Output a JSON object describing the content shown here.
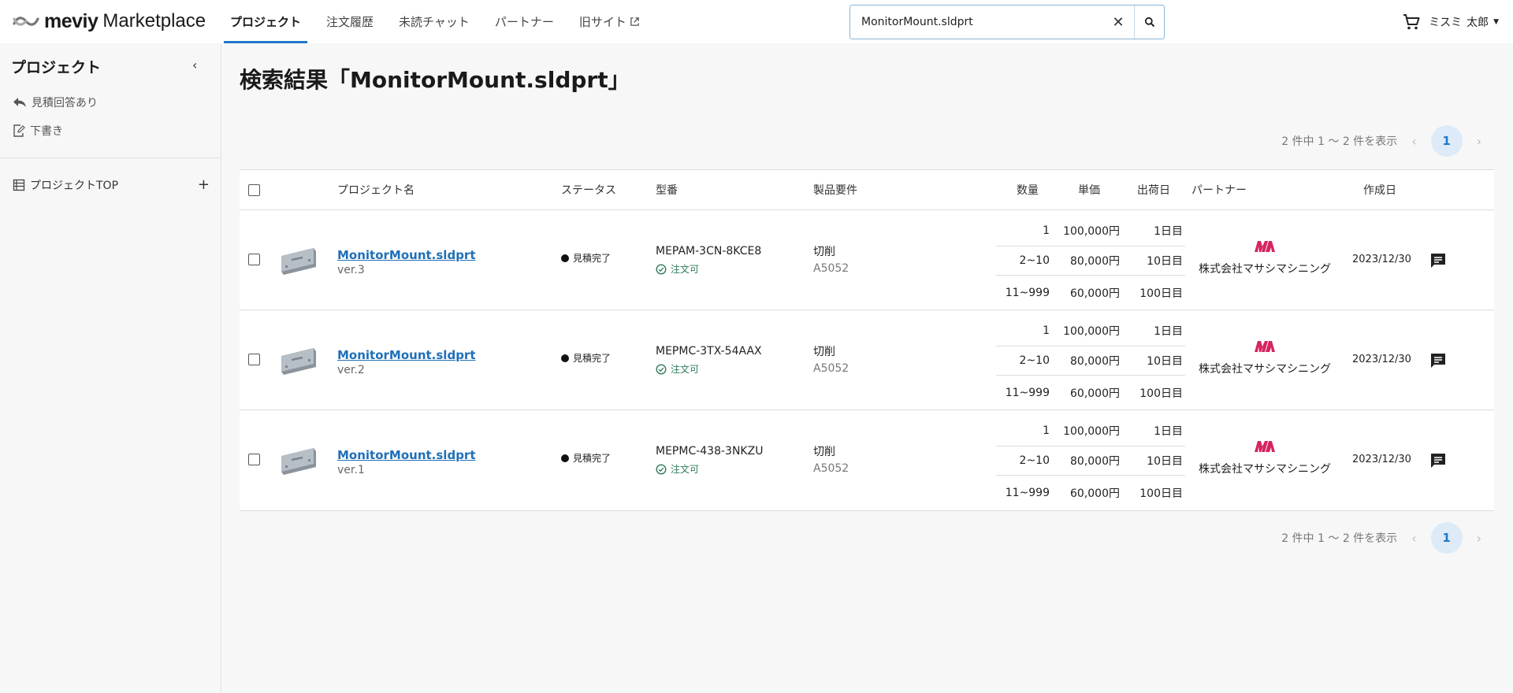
{
  "header": {
    "brand": "meviy",
    "brand_sub": "Marketplace",
    "nav": [
      "プロジェクト",
      "注文履歴",
      "未読チャット",
      "パートナー",
      "旧サイト"
    ],
    "search": {
      "value": "MonitorMount.sldprt",
      "clear": "✕"
    },
    "user": {
      "family": "ミスミ",
      "given": "太郎"
    }
  },
  "sidebar": {
    "title": "プロジェクト",
    "collapse": "‹",
    "links": [
      "見積回答あり",
      "下書き"
    ],
    "project_top": "プロジェクトTOP",
    "add": "+"
  },
  "main": {
    "title": "検索結果「MonitorMount.sldprt」",
    "pagination": {
      "summary": "2 件中 1 〜 2 件を表示",
      "current_page": "1",
      "prev": "‹",
      "next": "›"
    },
    "columns": {
      "name": "プロジェクト名",
      "status": "ステータス",
      "model": "型番",
      "requirements": "製品要件",
      "quantity": "数量",
      "unit_price": "単価",
      "ship_day": "出荷日",
      "partner": "パートナー",
      "created": "作成日"
    },
    "rows": [
      {
        "name": "MonitorMount.sldprt",
        "version": "ver.3",
        "status": "見積完了",
        "model": "MEPAM-3CN-8KCE8",
        "orderable": "注文可",
        "process": "切削",
        "material": "A5052",
        "prices": [
          {
            "qty": "1",
            "price": "100,000円",
            "days": "1日目"
          },
          {
            "qty": "2~10",
            "price": "80,000円",
            "days": "10日目"
          },
          {
            "qty": "11~999",
            "price": "60,000円",
            "days": "100日目"
          }
        ],
        "partner": "株式会社マサシマシニング",
        "created": "2023/12/30"
      },
      {
        "name": "MonitorMount.sldprt",
        "version": "ver.2",
        "status": "見積完了",
        "model": "MEPMC-3TX-54AAX",
        "orderable": "注文可",
        "process": "切削",
        "material": "A5052",
        "prices": [
          {
            "qty": "1",
            "price": "100,000円",
            "days": "1日目"
          },
          {
            "qty": "2~10",
            "price": "80,000円",
            "days": "10日目"
          },
          {
            "qty": "11~999",
            "price": "60,000円",
            "days": "100日目"
          }
        ],
        "partner": "株式会社マサシマシニング",
        "created": "2023/12/30"
      },
      {
        "name": "MonitorMount.sldprt",
        "version": "ver.1",
        "status": "見積完了",
        "model": "MEPMC-438-3NKZU",
        "orderable": "注文可",
        "process": "切削",
        "material": "A5052",
        "prices": [
          {
            "qty": "1",
            "price": "100,000円",
            "days": "1日目"
          },
          {
            "qty": "2~10",
            "price": "80,000円",
            "days": "10日目"
          },
          {
            "qty": "11~999",
            "price": "60,000円",
            "days": "100日目"
          }
        ],
        "partner": "株式会社マサシマシニング",
        "created": "2023/12/30"
      }
    ]
  },
  "colors": {
    "accent": "#1f78c8",
    "link": "#1f6fb8",
    "ok": "#2e7d5b",
    "partner_logo": "#d6245f"
  }
}
